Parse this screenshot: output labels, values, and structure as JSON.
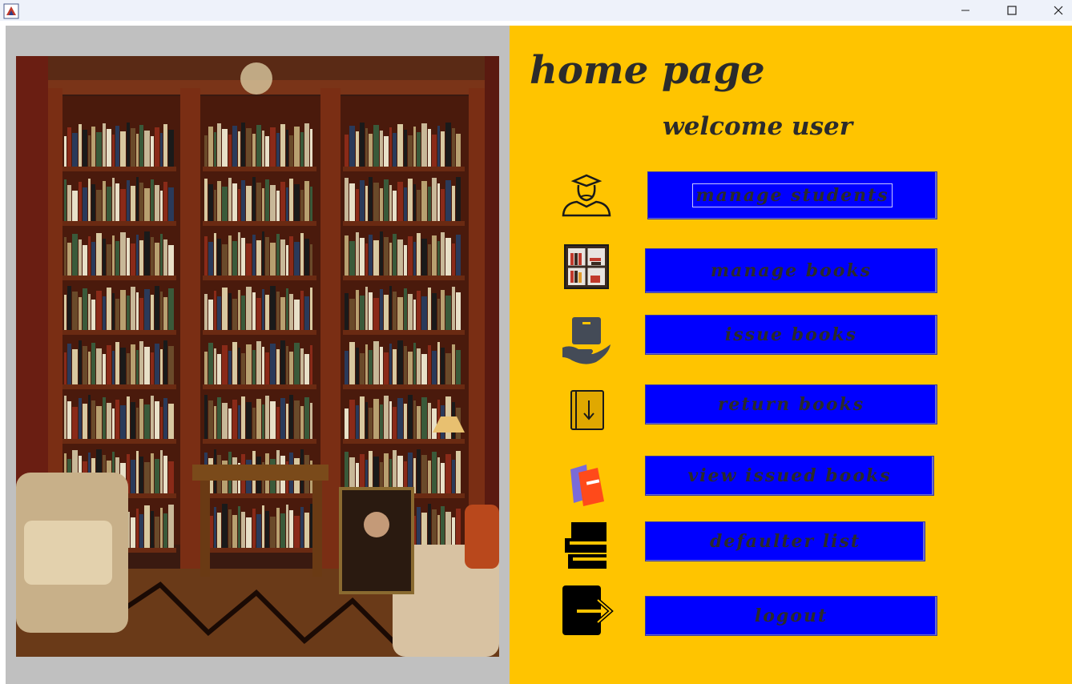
{
  "window": {
    "minimize_icon": "minimize-icon",
    "maximize_icon": "maximize-icon",
    "close_icon": "close-icon"
  },
  "header": {
    "title": "home page",
    "welcome": "welcome user"
  },
  "menu": [
    {
      "label": "manage students",
      "icon": "student-icon"
    },
    {
      "label": "manage books",
      "icon": "bookshelf-icon"
    },
    {
      "label": "issue books",
      "icon": "hand-box-icon"
    },
    {
      "label": "return books",
      "icon": "book-return-icon"
    },
    {
      "label": "view issued books",
      "icon": "books-stack-icon"
    },
    {
      "label": "defaulter list",
      "icon": "book-pile-icon"
    },
    {
      "label": "logout",
      "icon": "logout-icon"
    }
  ],
  "colors": {
    "right_panel": "#ffc400",
    "left_panel": "#c0c0c0",
    "button": "#0000ff",
    "button_text": "#2b2b2b"
  }
}
